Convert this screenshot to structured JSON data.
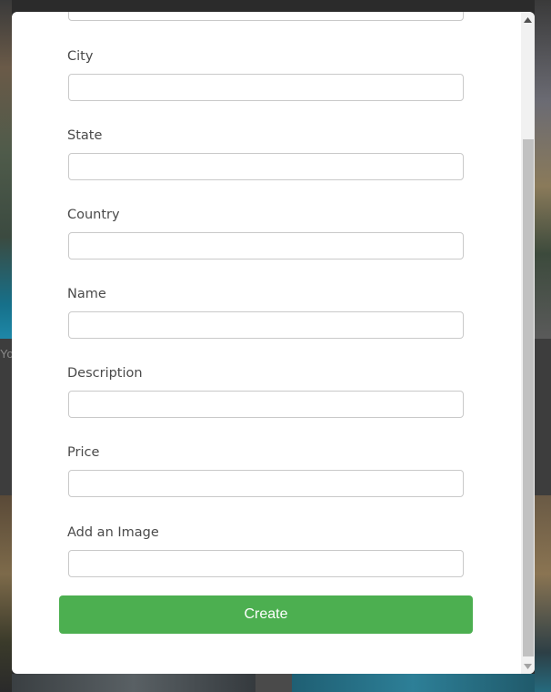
{
  "background": {
    "partial_text": "Yo"
  },
  "form": {
    "fields": [
      {
        "label": "City",
        "value": ""
      },
      {
        "label": "State",
        "value": ""
      },
      {
        "label": "Country",
        "value": ""
      },
      {
        "label": "Name",
        "value": ""
      },
      {
        "label": "Description",
        "value": ""
      },
      {
        "label": "Price",
        "value": ""
      },
      {
        "label": "Add an Image",
        "value": ""
      }
    ],
    "submit_label": "Create"
  },
  "colors": {
    "accent": "#4caf50",
    "overlay": "#2b2b2b"
  },
  "icons": {
    "scroll_up": "triangle-up-icon",
    "scroll_down": "triangle-down-icon"
  }
}
